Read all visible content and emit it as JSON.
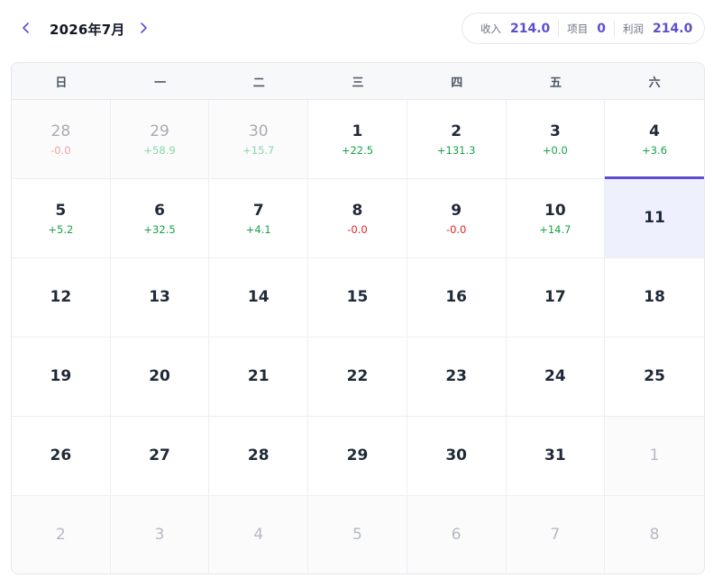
{
  "header": {
    "month_title": "2026年7月",
    "prev_icon": "chevron-left-icon",
    "next_icon": "chevron-right-icon"
  },
  "stats": {
    "income_label": "收入",
    "income_value": "214.0",
    "items_label": "项目",
    "items_value": "0",
    "profit_label": "利润",
    "profit_value": "214.0"
  },
  "colors": {
    "accent": "#5b4fcf",
    "positive": "#16a34a",
    "negative": "#dc2626",
    "today_bg": "#eef1fd"
  },
  "weekdays": [
    "日",
    "一",
    "二",
    "三",
    "四",
    "五",
    "六"
  ],
  "days": [
    {
      "day": "28",
      "amount": "-0.0",
      "sign": "neg",
      "other": true
    },
    {
      "day": "29",
      "amount": "+58.9",
      "sign": "pos",
      "other": true
    },
    {
      "day": "30",
      "amount": "+15.7",
      "sign": "pos",
      "other": true
    },
    {
      "day": "1",
      "amount": "+22.5",
      "sign": "pos"
    },
    {
      "day": "2",
      "amount": "+131.3",
      "sign": "pos"
    },
    {
      "day": "3",
      "amount": "+0.0",
      "sign": "pos"
    },
    {
      "day": "4",
      "amount": "+3.6",
      "sign": "pos",
      "selected_below": true
    },
    {
      "day": "5",
      "amount": "+5.2",
      "sign": "pos"
    },
    {
      "day": "6",
      "amount": "+32.5",
      "sign": "pos"
    },
    {
      "day": "7",
      "amount": "+4.1",
      "sign": "pos"
    },
    {
      "day": "8",
      "amount": "-0.0",
      "sign": "neg"
    },
    {
      "day": "9",
      "amount": "-0.0",
      "sign": "neg"
    },
    {
      "day": "10",
      "amount": "+14.7",
      "sign": "pos"
    },
    {
      "day": "11",
      "amount": "",
      "today": true
    },
    {
      "day": "12",
      "amount": ""
    },
    {
      "day": "13",
      "amount": ""
    },
    {
      "day": "14",
      "amount": ""
    },
    {
      "day": "15",
      "amount": ""
    },
    {
      "day": "16",
      "amount": ""
    },
    {
      "day": "17",
      "amount": ""
    },
    {
      "day": "18",
      "amount": ""
    },
    {
      "day": "19",
      "amount": ""
    },
    {
      "day": "20",
      "amount": ""
    },
    {
      "day": "21",
      "amount": ""
    },
    {
      "day": "22",
      "amount": ""
    },
    {
      "day": "23",
      "amount": ""
    },
    {
      "day": "24",
      "amount": ""
    },
    {
      "day": "25",
      "amount": ""
    },
    {
      "day": "26",
      "amount": ""
    },
    {
      "day": "27",
      "amount": ""
    },
    {
      "day": "28",
      "amount": ""
    },
    {
      "day": "29",
      "amount": ""
    },
    {
      "day": "30",
      "amount": ""
    },
    {
      "day": "31",
      "amount": ""
    },
    {
      "day": "1",
      "amount": "",
      "other": true
    },
    {
      "day": "2",
      "amount": "",
      "other": true
    },
    {
      "day": "3",
      "amount": "",
      "other": true
    },
    {
      "day": "4",
      "amount": "",
      "other": true
    },
    {
      "day": "5",
      "amount": "",
      "other": true
    },
    {
      "day": "6",
      "amount": "",
      "other": true
    },
    {
      "day": "7",
      "amount": "",
      "other": true
    },
    {
      "day": "8",
      "amount": "",
      "other": true
    }
  ]
}
